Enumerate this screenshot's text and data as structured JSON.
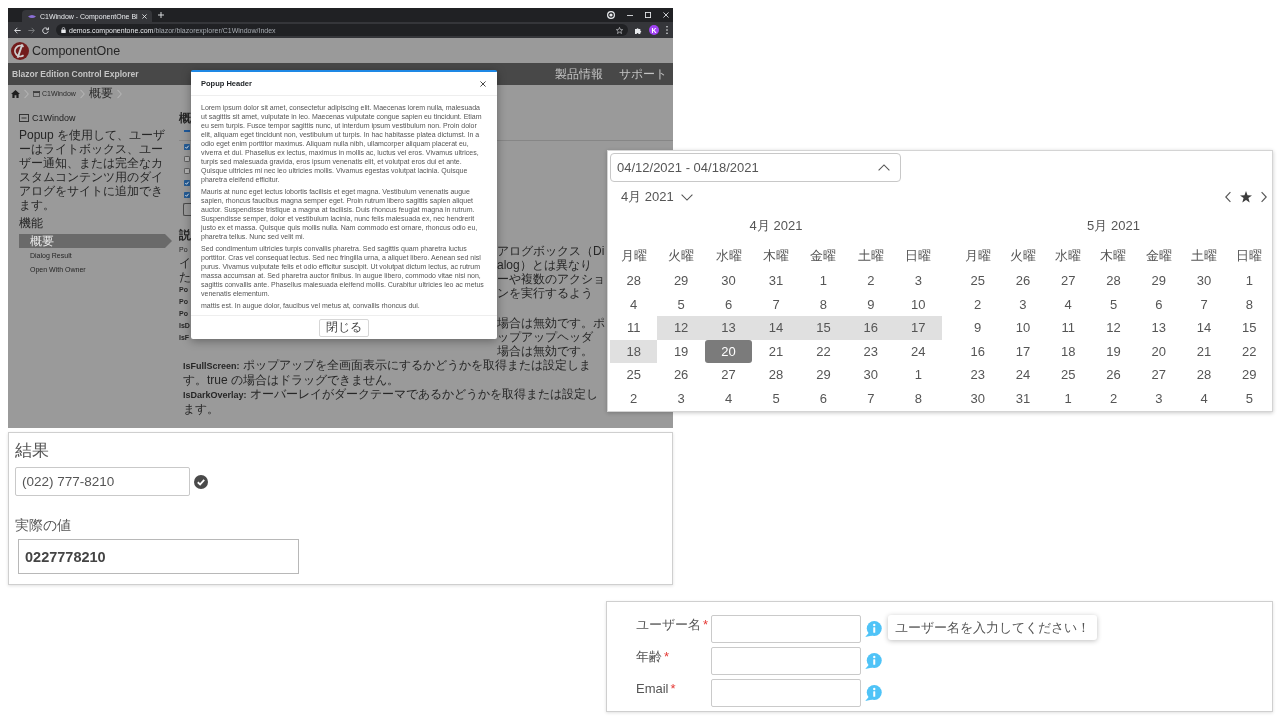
{
  "browser": {
    "tab": {
      "title": "C1Window - ComponentOne Bl"
    },
    "address": {
      "host": "demos.componentone.com",
      "path": "/blazor/blazorexplorer/C1Window/Index"
    },
    "profile": {
      "initial": "K"
    }
  },
  "site": {
    "logo": "ComponentOne",
    "nav": {
      "title": "Blazor Edition Control Explorer",
      "links": [
        "製品情報",
        "サポート"
      ]
    },
    "breadcrumb": [
      {
        "kind": "page",
        "label": "C1Window"
      },
      {
        "kind": "current",
        "label": "概要"
      }
    ],
    "sidebar": {
      "title": "C1Window",
      "description": "Popup を使用して、ユーザーはライトボックス、ユーザー通知、または完全なカスタムコンテンツ用のダイアログをサイトに追加できます。",
      "section": "機能",
      "items": [
        {
          "label": "概要",
          "selected": true
        },
        {
          "label": "Dialog Result",
          "selected": false
        },
        {
          "label": "Open With Owner",
          "selected": false
        }
      ]
    },
    "content": {
      "heading": "概",
      "options": [
        {
          "checked": true
        },
        {
          "checked": false
        },
        {
          "checked": false
        },
        {
          "checked": true
        },
        {
          "checked": true
        }
      ],
      "heading_2": "説",
      "rows": [
        {
          "kind": "text",
          "left": "Po",
          "right": "アログボックス（Dialog）とは異なり"
        },
        {
          "kind": "text",
          "left": "イ",
          "right": "ーや複数のアクションを実行するよう"
        },
        {
          "kind": "text",
          "left": "た"
        },
        {
          "kind": "property",
          "left": "Po"
        },
        {
          "kind": "property",
          "left": "Po"
        },
        {
          "kind": "property",
          "left": "Po"
        },
        {
          "kind": "property",
          "left": "IsD",
          "right": "場合は無効です。ポップアップヘッダ"
        },
        {
          "kind": "property",
          "left": "IsF",
          "right": "場合は無効です。"
        }
      ],
      "lines": [
        "**IsFullScreen:** ポップアップを全画面表示にするかどうかを取得または設定します。true の場合はドラッグできません。",
        "**IsDarkOverlay:** オーバーレイがダークテーマであるかどうかを取得または設定します。"
      ]
    }
  },
  "popup": {
    "header": "Popup Header",
    "paragraphs": [
      "Lorem ipsum dolor sit amet, consectetur adipiscing elit. Maecenas lorem nulla, malesuada ut sagittis sit amet, vulputate in leo. Maecenas vulputate congue sapien eu tincidunt. Etiam eu sem turpis. Fusce tempor sagittis nunc, ut interdum ipsum vestibulum non. Proin dolor elit, aliquam eget tincidunt non, vestibulum ut turpis. In hac habitasse platea dictumst. In a odio eget enim porttitor maximus. Aliquam nulla nibh, ullamcorper aliquam placerat eu, viverra et dui. Phasellus ex lectus, maximus in mollis ac, luctus vel eros. Vivamus ultrices, turpis sed malesuada gravida, eros ipsum venenatis elit, et volutpat eros dui et ante. Quisque ultricies mi nec leo ultricies mollis. Vivamus egestas volutpat lacinia. Quisque pharetra eleifend efficitur.",
      "Mauris at nunc eget lectus lobortis facilisis et eget magna. Vestibulum venenatis augue sapien, rhoncus faucibus magna semper eget. Proin rutrum libero sagittis sapien aliquet auctor. Suspendisse tristique a magna at facilisis. Duis rhoncus feugiat magna in rutrum. Suspendisse semper, dolor et vestibulum lacinia, nunc felis malesuada ex, nec hendrerit justo ex et massa. Quisque quis mollis nulla. Nam commodo est ornare, rhoncus odio eu, pharetra tellus. Nunc sed velit mi.",
      "Sed condimentum ultricies turpis convallis pharetra. Sed sagittis quam pharetra luctus porttitor. Cras vel consequat lectus. Sed nec fringilla urna, a aliquet libero. Aenean sed nisl purus. Vivamus vulputate felis et odio efficitur suscipit. Ut volutpat dictum lectus, ac rutrum massa accumsan at. Sed pharetra auctor finibus. In augue libero, commodo vitae nisi non, sagittis convallis ante. Phasellus malesuada eleifend mollis. Curabitur ultricies leo ac metus venenatis elementum.",
      "mattis est. In augue dolor, faucibus vel metus at, convallis rhoncus dui."
    ],
    "button": "閉じる"
  },
  "date_range_picker": {
    "value": "04/12/2021 - 04/18/2021",
    "expanded": true,
    "header": "4月 2021",
    "months": [
      {
        "title": "4月 2021",
        "weekdays": [
          "月曜",
          "火曜",
          "水曜",
          "木曜",
          "金曜",
          "土曜",
          "日曜"
        ],
        "weeks": [
          [
            {
              "day": "28",
              "selected": false,
              "today": false
            },
            {
              "day": "29",
              "selected": false,
              "today": false
            },
            {
              "day": "30",
              "selected": false,
              "today": false
            },
            {
              "day": "31",
              "selected": false,
              "today": false
            },
            {
              "day": "1",
              "selected": false,
              "today": false
            },
            {
              "day": "2",
              "selected": false,
              "today": false
            },
            {
              "day": "3",
              "selected": false,
              "today": false
            }
          ],
          [
            {
              "day": "4",
              "selected": false,
              "today": false
            },
            {
              "day": "5",
              "selected": false,
              "today": false
            },
            {
              "day": "6",
              "selected": false,
              "today": false
            },
            {
              "day": "7",
              "selected": false,
              "today": false
            },
            {
              "day": "8",
              "selected": false,
              "today": false
            },
            {
              "day": "9",
              "selected": false,
              "today": false
            },
            {
              "day": "10",
              "selected": false,
              "today": false
            }
          ],
          [
            {
              "day": "11",
              "selected": false,
              "today": false
            },
            {
              "day": "12",
              "selected": true,
              "today": false
            },
            {
              "day": "13",
              "selected": true,
              "today": false
            },
            {
              "day": "14",
              "selected": true,
              "today": false
            },
            {
              "day": "15",
              "selected": true,
              "today": false
            },
            {
              "day": "16",
              "selected": true,
              "today": false
            },
            {
              "day": "17",
              "selected": true,
              "today": false
            }
          ],
          [
            {
              "day": "18",
              "selected": true,
              "today": false
            },
            {
              "day": "19",
              "selected": false,
              "today": false
            },
            {
              "day": "20",
              "selected": false,
              "today": true
            },
            {
              "day": "21",
              "selected": false,
              "today": false
            },
            {
              "day": "22",
              "selected": false,
              "today": false
            },
            {
              "day": "23",
              "selected": false,
              "today": false
            },
            {
              "day": "24",
              "selected": false,
              "today": false
            }
          ],
          [
            {
              "day": "25",
              "selected": false,
              "today": false
            },
            {
              "day": "26",
              "selected": false,
              "today": false
            },
            {
              "day": "27",
              "selected": false,
              "today": false
            },
            {
              "day": "28",
              "selected": false,
              "today": false
            },
            {
              "day": "29",
              "selected": false,
              "today": false
            },
            {
              "day": "30",
              "selected": false,
              "today": false
            },
            {
              "day": "1",
              "selected": false,
              "today": false
            }
          ],
          [
            {
              "day": "2",
              "selected": false,
              "today": false
            },
            {
              "day": "3",
              "selected": false,
              "today": false
            },
            {
              "day": "4",
              "selected": false,
              "today": false
            },
            {
              "day": "5",
              "selected": false,
              "today": false
            },
            {
              "day": "6",
              "selected": false,
              "today": false
            },
            {
              "day": "7",
              "selected": false,
              "today": false
            },
            {
              "day": "8",
              "selected": false,
              "today": false
            }
          ]
        ]
      },
      {
        "title": "5月 2021",
        "weekdays": [
          "月曜",
          "火曜",
          "水曜",
          "木曜",
          "金曜",
          "土曜",
          "日曜"
        ],
        "weeks": [
          [
            {
              "day": "25",
              "selected": false,
              "today": false
            },
            {
              "day": "26",
              "selected": false,
              "today": false
            },
            {
              "day": "27",
              "selected": false,
              "today": false
            },
            {
              "day": "28",
              "selected": false,
              "today": false
            },
            {
              "day": "29",
              "selected": false,
              "today": false
            },
            {
              "day": "30",
              "selected": false,
              "today": false
            },
            {
              "day": "1",
              "selected": false,
              "today": false
            }
          ],
          [
            {
              "day": "2",
              "selected": false,
              "today": false
            },
            {
              "day": "3",
              "selected": false,
              "today": false
            },
            {
              "day": "4",
              "selected": false,
              "today": false
            },
            {
              "day": "5",
              "selected": false,
              "today": false
            },
            {
              "day": "6",
              "selected": false,
              "today": false
            },
            {
              "day": "7",
              "selected": false,
              "today": false
            },
            {
              "day": "8",
              "selected": false,
              "today": false
            }
          ],
          [
            {
              "day": "9",
              "selected": false,
              "today": false
            },
            {
              "day": "10",
              "selected": false,
              "today": false
            },
            {
              "day": "11",
              "selected": false,
              "today": false
            },
            {
              "day": "12",
              "selected": false,
              "today": false
            },
            {
              "day": "13",
              "selected": false,
              "today": false
            },
            {
              "day": "14",
              "selected": false,
              "today": false
            },
            {
              "day": "15",
              "selected": false,
              "today": false
            }
          ],
          [
            {
              "day": "16",
              "selected": false,
              "today": false
            },
            {
              "day": "17",
              "selected": false,
              "today": false
            },
            {
              "day": "18",
              "selected": false,
              "today": false
            },
            {
              "day": "19",
              "selected": false,
              "today": false
            },
            {
              "day": "20",
              "selected": false,
              "today": false
            },
            {
              "day": "21",
              "selected": false,
              "today": false
            },
            {
              "day": "22",
              "selected": false,
              "today": false
            }
          ],
          [
            {
              "day": "23",
              "selected": false,
              "today": false
            },
            {
              "day": "24",
              "selected": false,
              "today": false
            },
            {
              "day": "25",
              "selected": false,
              "today": false
            },
            {
              "day": "26",
              "selected": false,
              "today": false
            },
            {
              "day": "27",
              "selected": false,
              "today": false
            },
            {
              "day": "28",
              "selected": false,
              "today": false
            },
            {
              "day": "29",
              "selected": false,
              "today": false
            }
          ],
          [
            {
              "day": "30",
              "selected": false,
              "today": false
            },
            {
              "day": "31",
              "selected": false,
              "today": false
            },
            {
              "day": "1",
              "selected": false,
              "today": false
            },
            {
              "day": "2",
              "selected": false,
              "today": false
            },
            {
              "day": "3",
              "selected": false,
              "today": false
            },
            {
              "day": "4",
              "selected": false,
              "today": false
            },
            {
              "day": "5",
              "selected": false,
              "today": false
            }
          ]
        ]
      }
    ]
  },
  "masked_input": {
    "label": "結果",
    "value": "(022) 777-8210",
    "valid": true,
    "raw_label": "実際の値",
    "raw_value": "0227778210"
  },
  "validation_form": {
    "fields": [
      {
        "label": "ユーザー名",
        "mark": "*",
        "tooltip": "ユーザー名を入力してください！"
      },
      {
        "label": "年齢",
        "mark": "*"
      },
      {
        "label": "Email",
        "mark": "*"
      }
    ]
  }
}
